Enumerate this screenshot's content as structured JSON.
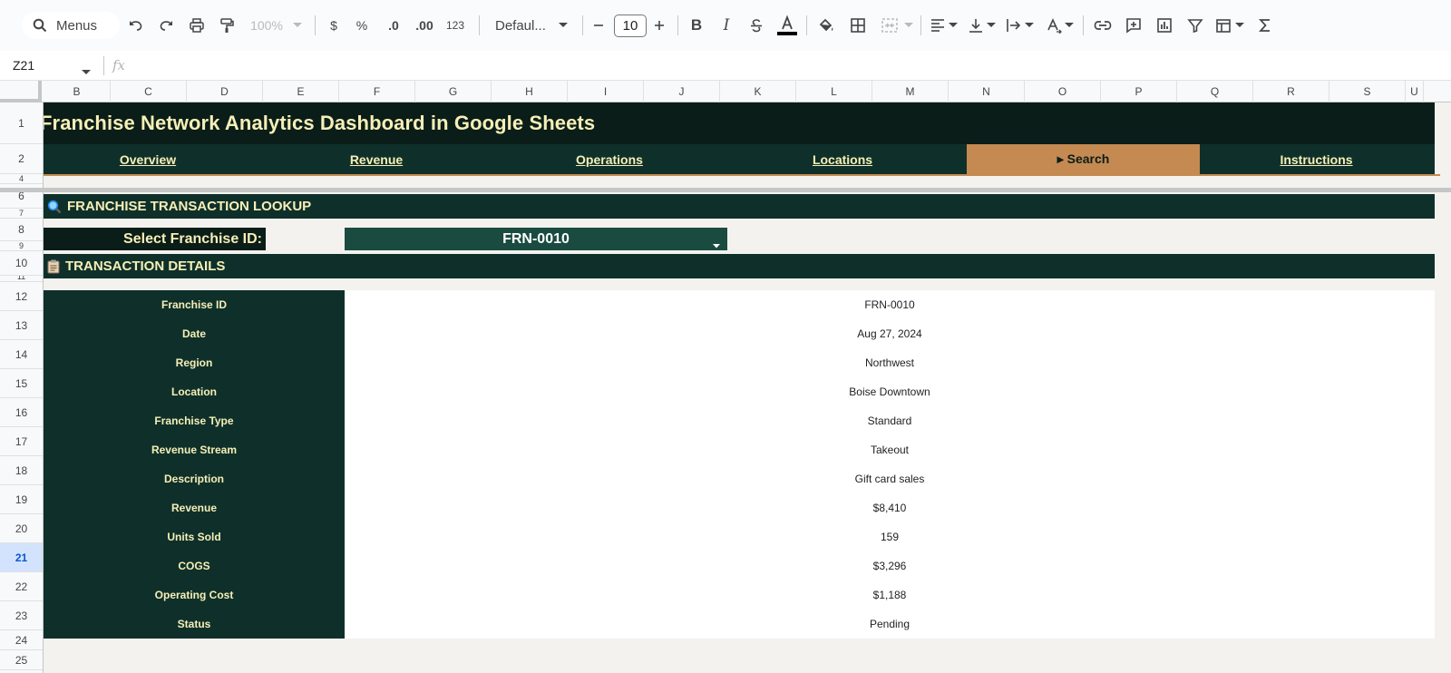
{
  "toolbar": {
    "menus_label": "Menus",
    "zoom": "100%",
    "currency": "$",
    "percent": "%",
    "decrease_decimal": ".0",
    "increase_decimal": ".00",
    "number_format": "123",
    "font": "Defaul...",
    "font_size": "10"
  },
  "formula_bar": {
    "name_box": "Z21",
    "fx": "fx"
  },
  "columns": [
    "B",
    "C",
    "D",
    "E",
    "F",
    "G",
    "H",
    "I",
    "J",
    "K",
    "L",
    "M",
    "N",
    "O",
    "P",
    "Q",
    "R",
    "S",
    "U"
  ],
  "rows": [
    "1",
    "2",
    "4",
    "6",
    "7",
    "8",
    "9",
    "10",
    "11",
    "12",
    "13",
    "14",
    "15",
    "16",
    "17",
    "18",
    "19",
    "20",
    "21",
    "22",
    "23",
    "24",
    "25"
  ],
  "selected_row": "21",
  "sheet": {
    "title": "Franchise Network Analytics Dashboard in Google Sheets",
    "nav": [
      {
        "label": "Overview"
      },
      {
        "label": "Revenue"
      },
      {
        "label": "Operations"
      },
      {
        "label": "Locations"
      },
      {
        "label": "▸ Search"
      },
      {
        "label": "Instructions"
      }
    ],
    "lookup_header": "FRANCHISE TRANSACTION LOOKUP",
    "select_label": "Select Franchise ID:",
    "selected_id": "FRN-0010",
    "details_header": "TRANSACTION DETAILS",
    "details": [
      {
        "label": "Franchise ID",
        "value": "FRN-0010"
      },
      {
        "label": "Date",
        "value": "Aug 27, 2024"
      },
      {
        "label": "Region",
        "value": "Northwest"
      },
      {
        "label": "Location",
        "value": "Boise Downtown"
      },
      {
        "label": "Franchise Type",
        "value": "Standard"
      },
      {
        "label": "Revenue Stream",
        "value": "Takeout"
      },
      {
        "label": "Description",
        "value": "Gift card sales"
      },
      {
        "label": "Revenue",
        "value": "$8,410"
      },
      {
        "label": "Units Sold",
        "value": "159"
      },
      {
        "label": "COGS",
        "value": "$3,296"
      },
      {
        "label": "Operating Cost",
        "value": "$1,188"
      },
      {
        "label": "Status",
        "value": "Pending"
      }
    ]
  },
  "colors": {
    "dark_band": "#0a1d18",
    "section_band": "#0f302a",
    "accent": "#c48a52",
    "title_text": "#f6efb7"
  }
}
